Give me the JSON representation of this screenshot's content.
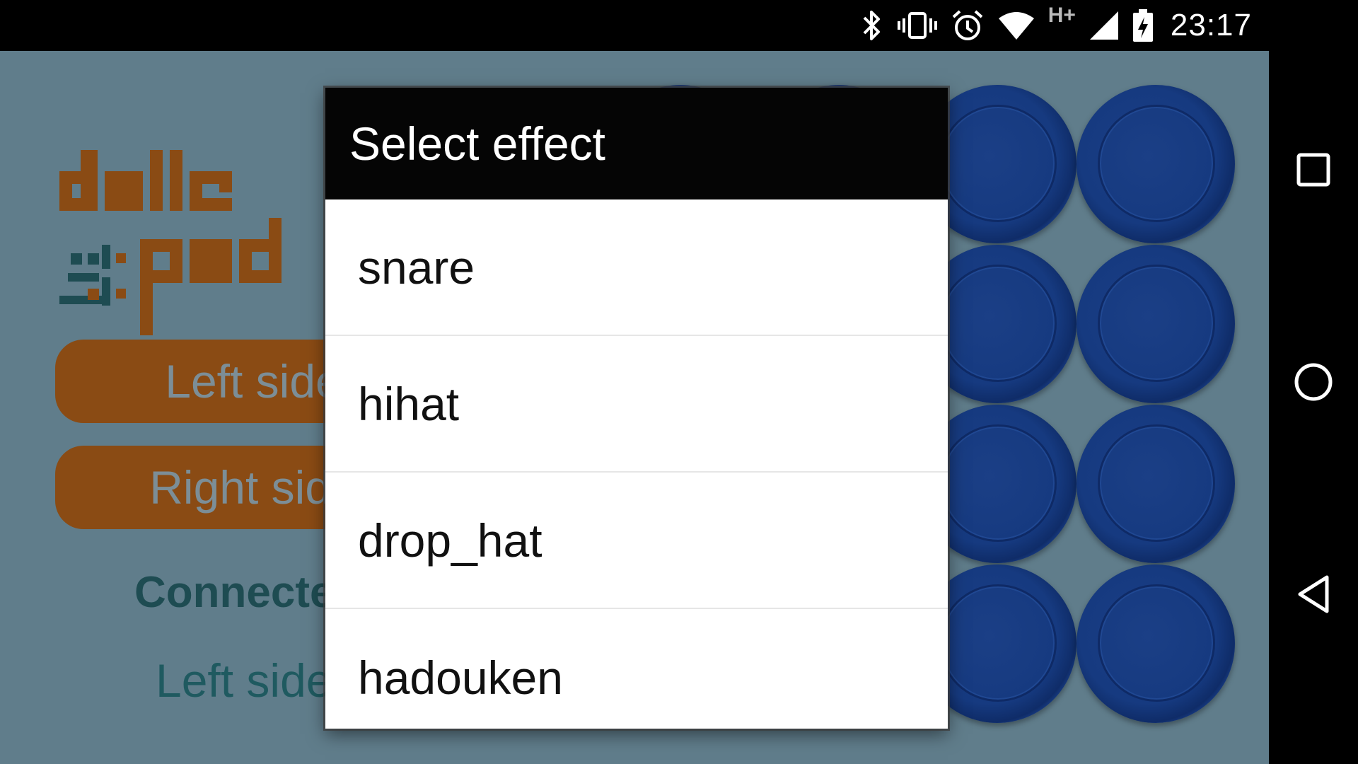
{
  "status_bar": {
    "clock": "23:17",
    "network_label": "H+",
    "icons": [
      "bluetooth-icon",
      "vibrate-icon",
      "alarm-icon",
      "wifi-icon",
      "cell-signal-icon",
      "battery-charging-icon"
    ]
  },
  "app": {
    "logo_alt": "dalle pad",
    "left_side_button": "Left side",
    "right_side_button": "Right side",
    "connected_label": "Connected",
    "status_line": "Left side"
  },
  "dialog": {
    "title": "Select effect",
    "items": [
      "snare",
      "hihat",
      "drop_hat",
      "hadouken"
    ]
  },
  "colors": {
    "app_background": "#607d8b",
    "button_orange": "#8a4b14",
    "pad_blue": "#163a80",
    "dialog_title_bg": "#050505"
  },
  "nav_bar": {
    "icons": [
      "recent-apps-icon",
      "home-icon",
      "back-icon"
    ]
  }
}
